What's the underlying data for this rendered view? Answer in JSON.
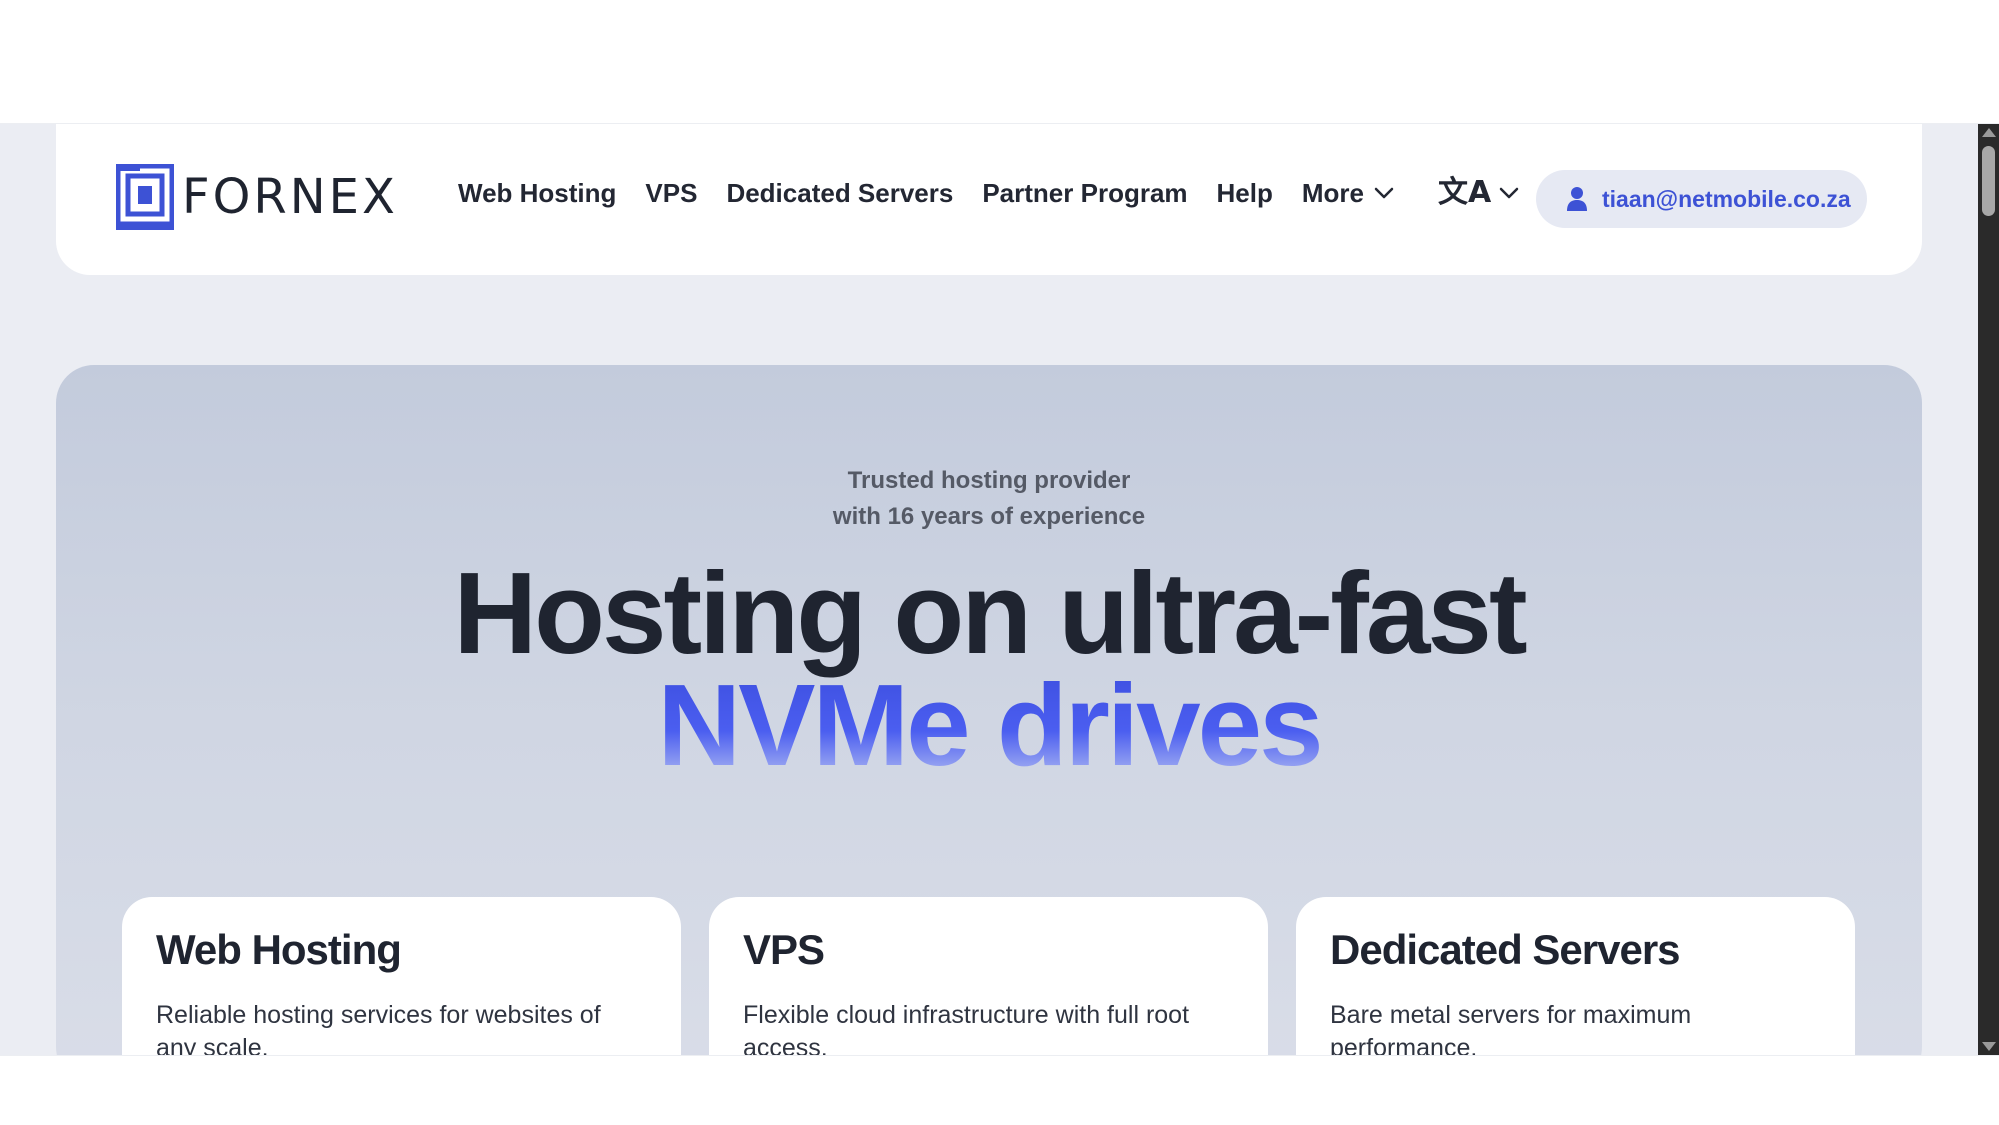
{
  "brand": {
    "name": "FORNEX",
    "color": "#3d52d5"
  },
  "nav": {
    "items": [
      {
        "label": "Web Hosting"
      },
      {
        "label": "VPS"
      },
      {
        "label": "Dedicated Servers"
      },
      {
        "label": "Partner Program"
      },
      {
        "label": "Help"
      }
    ],
    "more_label": "More"
  },
  "language": {
    "icon": "translate-icon",
    "glyph": "文A"
  },
  "account": {
    "email": "tiaan@netmobile.co.za",
    "icon": "user-icon"
  },
  "hero": {
    "tagline_line1": "Trusted hosting provider",
    "tagline_line2": "with 16 years of experience",
    "headline": "Hosting on ultra-fast",
    "headline_accent": "NVMe drives"
  },
  "cards": [
    {
      "title": "Web Hosting",
      "description": "Reliable hosting services for websites of any scale."
    },
    {
      "title": "VPS",
      "description": "Flexible cloud infrastructure with full root access."
    },
    {
      "title": "Dedicated Servers",
      "description": "Bare metal servers for maximum performance."
    }
  ]
}
